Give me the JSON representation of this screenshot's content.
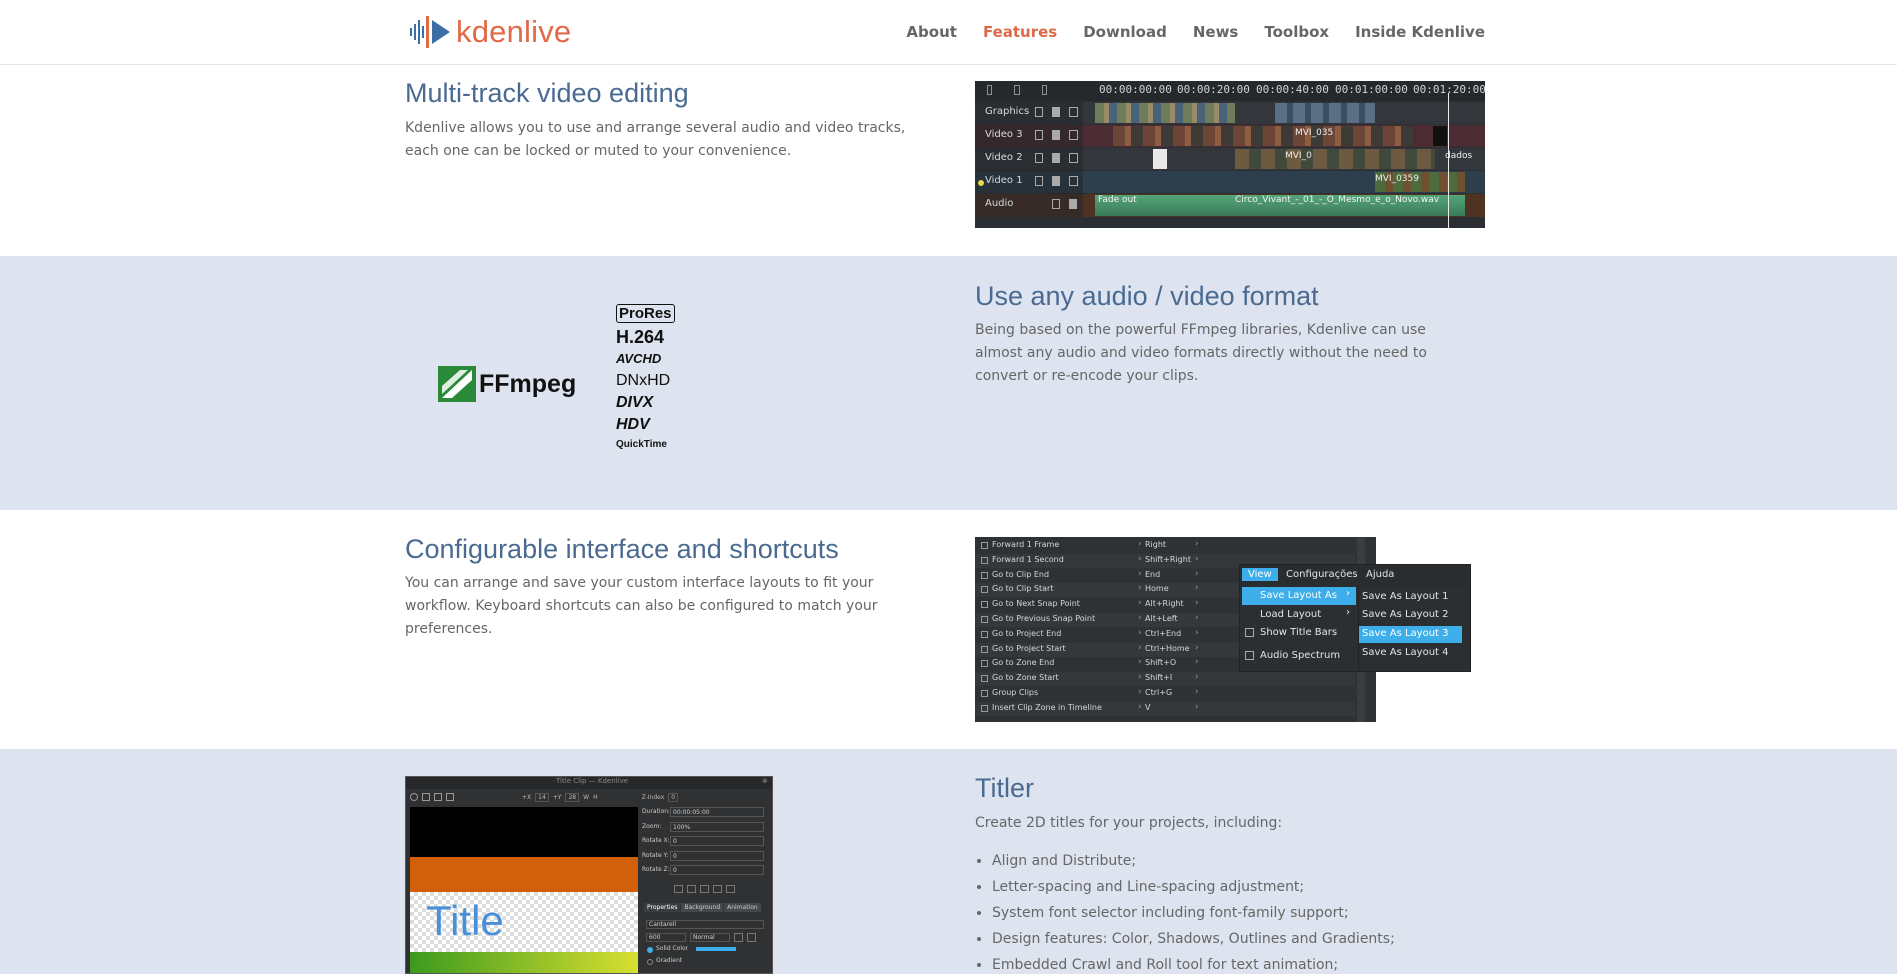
{
  "brand": {
    "name": "kdenlive",
    "accent": "#e06a48",
    "heading_color": "#4a6a91"
  },
  "nav": [
    {
      "label": "About",
      "active": false
    },
    {
      "label": "Features",
      "active": true
    },
    {
      "label": "Download",
      "active": false
    },
    {
      "label": "News",
      "active": false
    },
    {
      "label": "Toolbox",
      "active": false
    },
    {
      "label": "Inside Kdenlive",
      "active": false
    }
  ],
  "sections": {
    "multitrack": {
      "title": "Multi-track video editing",
      "body": "Kdenlive allows you to use and arrange several audio and video tracks, each one can be locked or muted to your convenience.",
      "timeline": {
        "timecodes": [
          "00:00:00:00",
          "00:00:20:00",
          "00:00:40:00",
          "00:01:00:00",
          "00:01:20:00"
        ],
        "tracks": [
          "Graphics",
          "Video 3",
          "Video 2",
          "Video 1",
          "Audio"
        ],
        "clip_labels": [
          "MVI_035",
          "MVI_0",
          "MVI_0359",
          "dados",
          "Fade out",
          "Circo_Vivant_-_01_-_O_Mesmo_e_o_Novo.wav"
        ]
      }
    },
    "formats": {
      "title": "Use any audio / video format",
      "body": "Being based on the powerful FFmpeg libraries, Kdenlive can use almost any audio and video formats directly without the need to convert or re-encode your clips.",
      "logos": {
        "ffmpeg": "FFmpeg",
        "list": [
          "ProRes",
          "H.264",
          "AVCHD",
          "DNxHD",
          "DIVX",
          "HDV",
          "QuickTime"
        ]
      }
    },
    "interface": {
      "title": "Configurable interface and shortcuts",
      "body": "You can arrange and save your custom interface layouts to fit your workflow. Keyboard shortcuts can also be configured to match your preferences.",
      "shortcuts": [
        {
          "action": "Forward 1 Frame",
          "key": "Right"
        },
        {
          "action": "Forward 1 Second",
          "key": "Shift+Right"
        },
        {
          "action": "Go to Clip End",
          "key": "End"
        },
        {
          "action": "Go to Clip Start",
          "key": "Home"
        },
        {
          "action": "Go to Next Snap Point",
          "key": "Alt+Right"
        },
        {
          "action": "Go to Previous Snap Point",
          "key": "Alt+Left"
        },
        {
          "action": "Go to Project End",
          "key": "Ctrl+End"
        },
        {
          "action": "Go to Project Start",
          "key": "Ctrl+Home"
        },
        {
          "action": "Go to Zone End",
          "key": "Shift+O"
        },
        {
          "action": "Go to Zone Start",
          "key": "Shift+I"
        },
        {
          "action": "Group Clips",
          "key": "Ctrl+G"
        },
        {
          "action": "Insert Clip Zone in Timeline",
          "key": "V"
        }
      ],
      "menubar": [
        "View",
        "Configurações",
        "Ajuda"
      ],
      "view_menu": [
        "Save Layout As",
        "Load Layout",
        "Show Title Bars",
        "Audio Spectrum"
      ],
      "submenu": [
        "Save As Layout 1",
        "Save As Layout 2",
        "Save As Layout 3",
        "Save As Layout 4"
      ]
    },
    "titler": {
      "title": "Titler",
      "intro": "Create 2D titles for your projects, including:",
      "features": [
        "Align and Distribute;",
        "Letter-spacing and Line-spacing adjustment;",
        "System font selector including font-family support;",
        "Design features: Color, Shadows, Outlines and Gradients;",
        "Embedded Crawl and Roll tool for text animation;"
      ],
      "window": {
        "caption": "Title Clip — Kdenlive",
        "preview_text": "Title",
        "fields": [
          {
            "label": "Duration:",
            "value": "00:00:05:00"
          },
          {
            "label": "Zoom:",
            "value": "100%"
          },
          {
            "label": "Rotate X:",
            "value": "0"
          },
          {
            "label": "Rotate Y:",
            "value": "0"
          },
          {
            "label": "Rotate Z:",
            "value": "0"
          }
        ],
        "tabs": [
          "Properties",
          "Background",
          "Animation"
        ],
        "font": "Cantarell",
        "font_size": "600",
        "font_weight": "Normal",
        "fill_options": [
          "Solid Color",
          "Gradient"
        ],
        "toolbar_labels": [
          "+X",
          "14",
          "+Y",
          "28",
          "W",
          "H",
          "Z-Index",
          "0"
        ]
      }
    }
  }
}
